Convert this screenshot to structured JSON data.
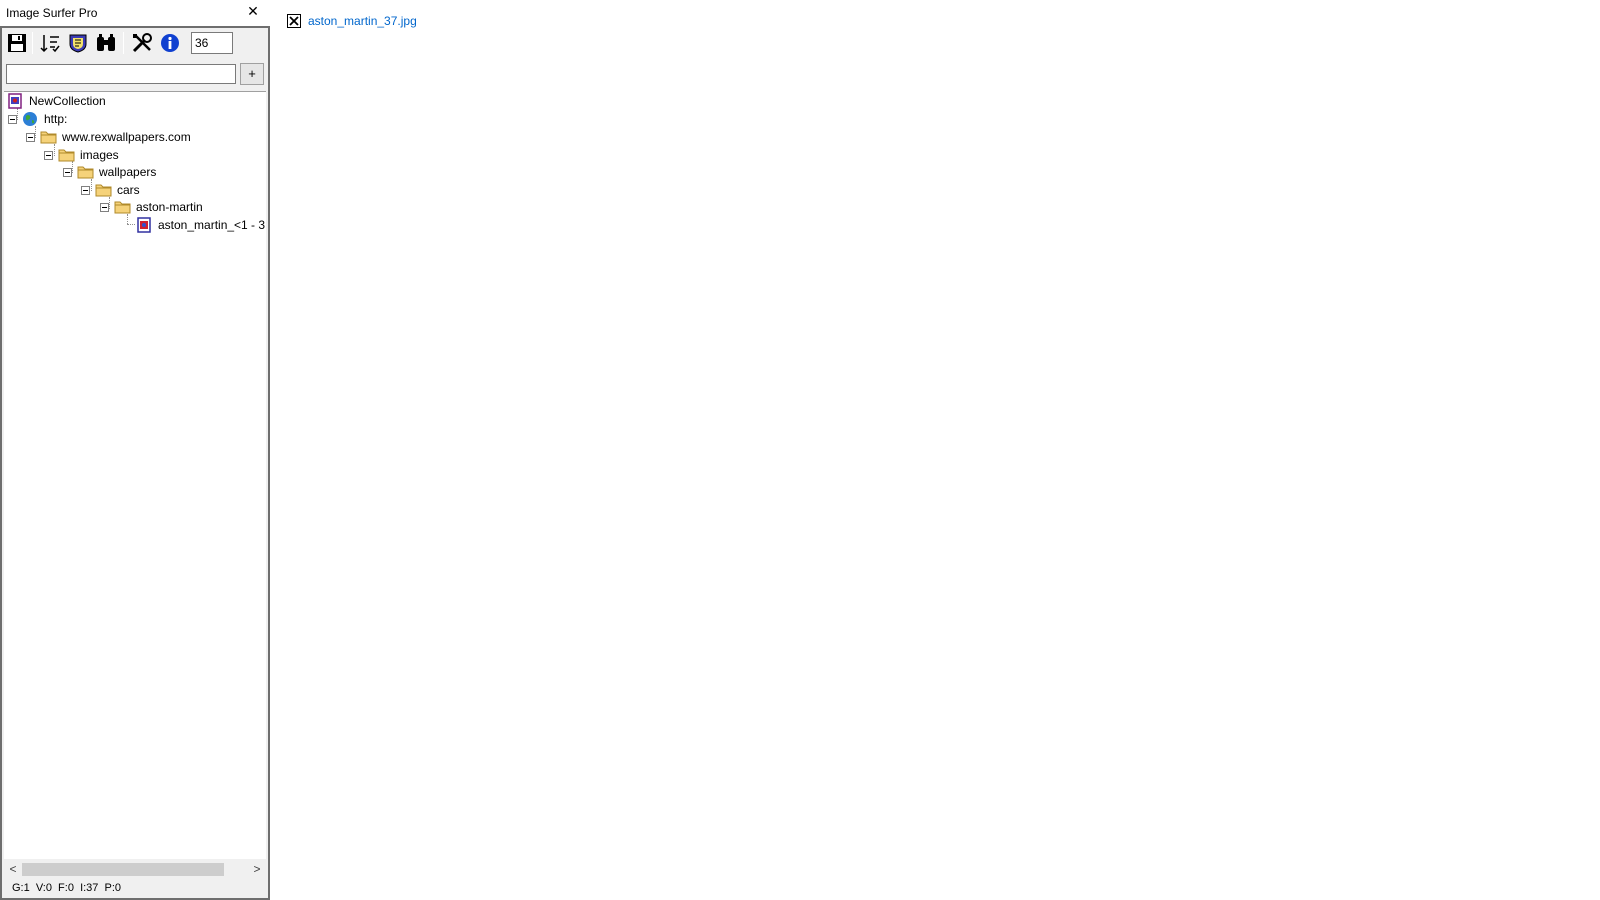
{
  "window": {
    "title": "Image Surfer Pro",
    "close_glyph": "✕"
  },
  "toolbar": {
    "buttons": [
      {
        "icon": "save-icon"
      },
      {
        "icon": "sort-icon"
      },
      {
        "icon": "filter-icon"
      },
      {
        "icon": "binoculars-icon"
      },
      {
        "icon": "tools-icon"
      },
      {
        "icon": "info-icon"
      }
    ],
    "count_value": "36"
  },
  "search": {
    "value": "",
    "add_label": "+"
  },
  "tree": {
    "nodes": [
      {
        "label": "NewCollection",
        "icon": "collection-icon"
      },
      {
        "label": "http:",
        "icon": "globe-icon"
      },
      {
        "label": "www.rexwallpapers.com",
        "icon": "folder-icon"
      },
      {
        "label": "images",
        "icon": "folder-icon"
      },
      {
        "label": "wallpapers",
        "icon": "folder-icon"
      },
      {
        "label": "cars",
        "icon": "folder-icon"
      },
      {
        "label": "aston-martin",
        "icon": "folder-icon"
      },
      {
        "label": "aston_martin_<1 - 3",
        "icon": "image-range-icon"
      }
    ]
  },
  "scrollbar": {
    "left_glyph": "<",
    "right_glyph": ">"
  },
  "status": {
    "text": "G:1  V:0  F:0  I:37  P:0"
  },
  "main": {
    "image_link": "aston_martin_37.jpg"
  },
  "colors": {
    "link": "#0066cc",
    "folder": "#f5d27a",
    "frame": "#6e6e6e"
  }
}
